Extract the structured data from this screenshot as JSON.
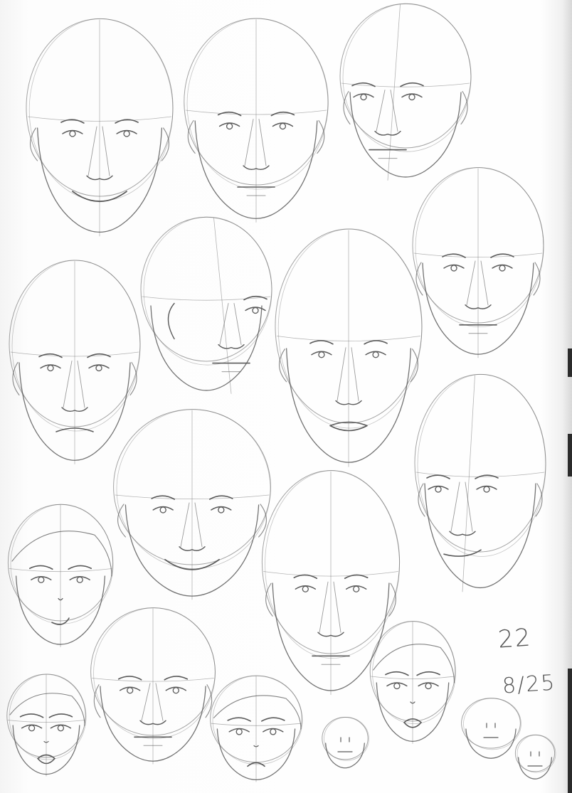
{
  "sheet": {
    "title": "",
    "ink_color": "#555555",
    "paper_color": "#fbfbfb"
  },
  "annotations": {
    "count": "22",
    "date": "8/25"
  }
}
